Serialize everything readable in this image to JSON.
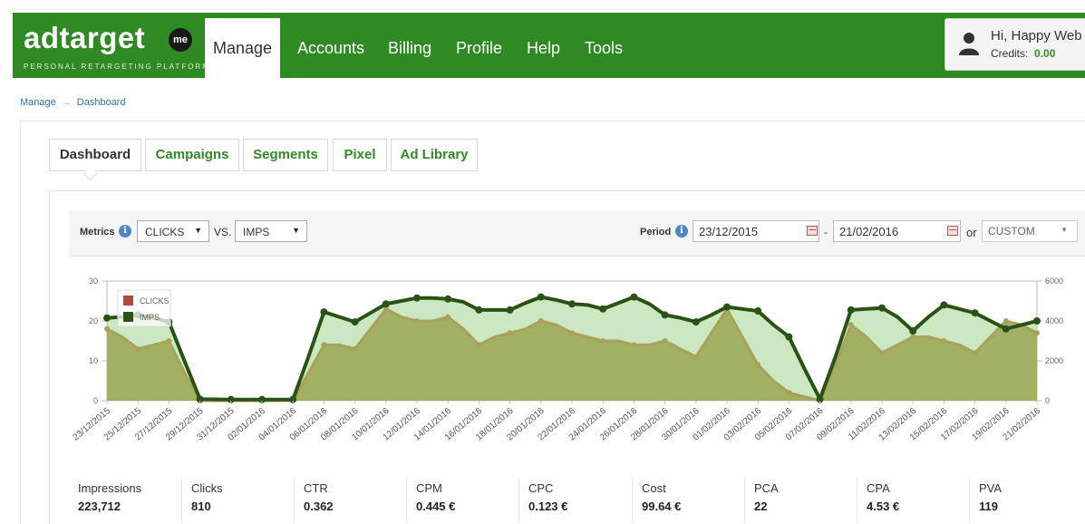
{
  "header": {
    "logo": {
      "word": "adtarget",
      "badge": "me",
      "tagline": "PERSONAL RETARGETING PLATFORM"
    },
    "nav": [
      "Manage",
      "Accounts",
      "Billing",
      "Profile",
      "Help",
      "Tools"
    ],
    "active_nav": "Manage",
    "user": {
      "greeting": "Hi, Happy Web",
      "credits_label": "Credits:",
      "credits_value": "0.00"
    }
  },
  "breadcrumb": [
    "Manage",
    "Dashboard"
  ],
  "tabs": [
    "Dashboard",
    "Campaigns",
    "Segments",
    "Pixel",
    "Ad Library"
  ],
  "active_tab": "Dashboard",
  "toolbar": {
    "metrics_label": "Metrics",
    "metric_a": "CLICKS",
    "vs_label": "VS.",
    "metric_b": "IMPS",
    "period_label": "Period",
    "date_from": "23/12/2015",
    "date_sep": "-",
    "date_to": "21/02/2016",
    "or_label": "or",
    "range_select": "CUSTOM"
  },
  "colors": {
    "brand_green": "#2f8a23",
    "imps_line": "#2a5214",
    "clicks_line": "#a8a25a",
    "clicks_legend": "#b5473e"
  },
  "chart_data": {
    "type": "area",
    "x": [
      "23/12/2015",
      "24/12/2015",
      "25/12/2015",
      "26/12/2015",
      "27/12/2015",
      "28/12/2015",
      "29/12/2015",
      "30/12/2015",
      "31/12/2015",
      "01/01/2016",
      "02/01/2016",
      "03/01/2016",
      "04/01/2016",
      "05/01/2016",
      "06/01/2016",
      "07/01/2016",
      "08/01/2016",
      "09/01/2016",
      "10/01/2016",
      "11/01/2016",
      "12/01/2016",
      "13/01/2016",
      "14/01/2016",
      "15/01/2016",
      "16/01/2016",
      "17/01/2016",
      "18/01/2016",
      "19/01/2016",
      "20/01/2016",
      "21/01/2016",
      "22/01/2016",
      "23/01/2016",
      "24/01/2016",
      "25/01/2016",
      "26/01/2016",
      "27/01/2016",
      "28/01/2016",
      "29/01/2016",
      "30/01/2016",
      "31/01/2016",
      "01/02/2016",
      "02/02/2016",
      "03/02/2016",
      "04/02/2016",
      "05/02/2016",
      "06/02/2016",
      "07/02/2016",
      "08/02/2016",
      "09/02/2016",
      "10/02/2016",
      "11/02/2016",
      "12/02/2016",
      "13/02/2016",
      "14/02/2016",
      "15/02/2016",
      "16/02/2016",
      "17/02/2016",
      "18/02/2016",
      "19/02/2016",
      "20/02/2016",
      "21/02/2016"
    ],
    "tick_labels": [
      "23/12/2015",
      "25/12/2015",
      "27/12/2015",
      "29/12/2015",
      "31/12/2015",
      "02/01/2016",
      "04/01/2016",
      "06/01/2016",
      "08/01/2016",
      "10/01/2016",
      "12/01/2016",
      "14/01/2016",
      "16/01/2016",
      "18/01/2016",
      "20/01/2016",
      "22/01/2016",
      "24/01/2016",
      "26/01/2016",
      "28/01/2016",
      "30/01/2016",
      "01/02/2016",
      "03/02/2016",
      "05/02/2016",
      "07/02/2016",
      "09/02/2016",
      "11/02/2016",
      "13/02/2016",
      "15/02/2016",
      "17/02/2016",
      "19/02/2016",
      "21/02/2016"
    ],
    "series": [
      {
        "name": "CLICKS",
        "axis": "left",
        "values": [
          18,
          16,
          13,
          14,
          15,
          7,
          0,
          0,
          0,
          0,
          0,
          0,
          0,
          7,
          14,
          14,
          13,
          18,
          23,
          21,
          20,
          20,
          21,
          18,
          14,
          16,
          17,
          18,
          20,
          19,
          17,
          16,
          15,
          15,
          14,
          14,
          15,
          13,
          11,
          17,
          23,
          16,
          9,
          5,
          2,
          1,
          0,
          9,
          19,
          16,
          12,
          14,
          16,
          16,
          15,
          14,
          12,
          16,
          20,
          19,
          17
        ]
      },
      {
        "name": "IMPS",
        "axis": "right",
        "values": [
          4150,
          4200,
          4300,
          4150,
          3950,
          2000,
          80,
          70,
          60,
          60,
          60,
          60,
          60,
          2200,
          4450,
          4200,
          3950,
          4400,
          4850,
          5000,
          5150,
          5150,
          5100,
          4950,
          4550,
          4550,
          4550,
          4900,
          5200,
          5050,
          4850,
          4800,
          4600,
          4900,
          5200,
          4850,
          4300,
          4150,
          3950,
          4300,
          4700,
          4600,
          4500,
          3800,
          3200,
          1600,
          80,
          2200,
          4550,
          4600,
          4650,
          4200,
          3500,
          4200,
          4800,
          4600,
          4400,
          4000,
          3600,
          3800,
          4000
        ]
      }
    ],
    "yleft_lim": [
      0,
      30
    ],
    "yleft_ticks": [
      0,
      10,
      20,
      30
    ],
    "yright_lim": [
      0,
      6000
    ],
    "yright_ticks": [
      0,
      2000,
      4000,
      6000
    ],
    "legend_position": "top-left",
    "grid": false
  },
  "stats": [
    {
      "label": "Impressions",
      "value": "223,712"
    },
    {
      "label": "Clicks",
      "value": "810"
    },
    {
      "label": "CTR",
      "value": "0.362"
    },
    {
      "label": "CPM",
      "value": "0.445 €"
    },
    {
      "label": "CPC",
      "value": "0.123 €"
    },
    {
      "label": "Cost",
      "value": "99.64 €"
    },
    {
      "label": "PCA",
      "value": "22"
    },
    {
      "label": "CPA",
      "value": "4.53 €"
    },
    {
      "label": "PVA",
      "value": "119"
    }
  ]
}
